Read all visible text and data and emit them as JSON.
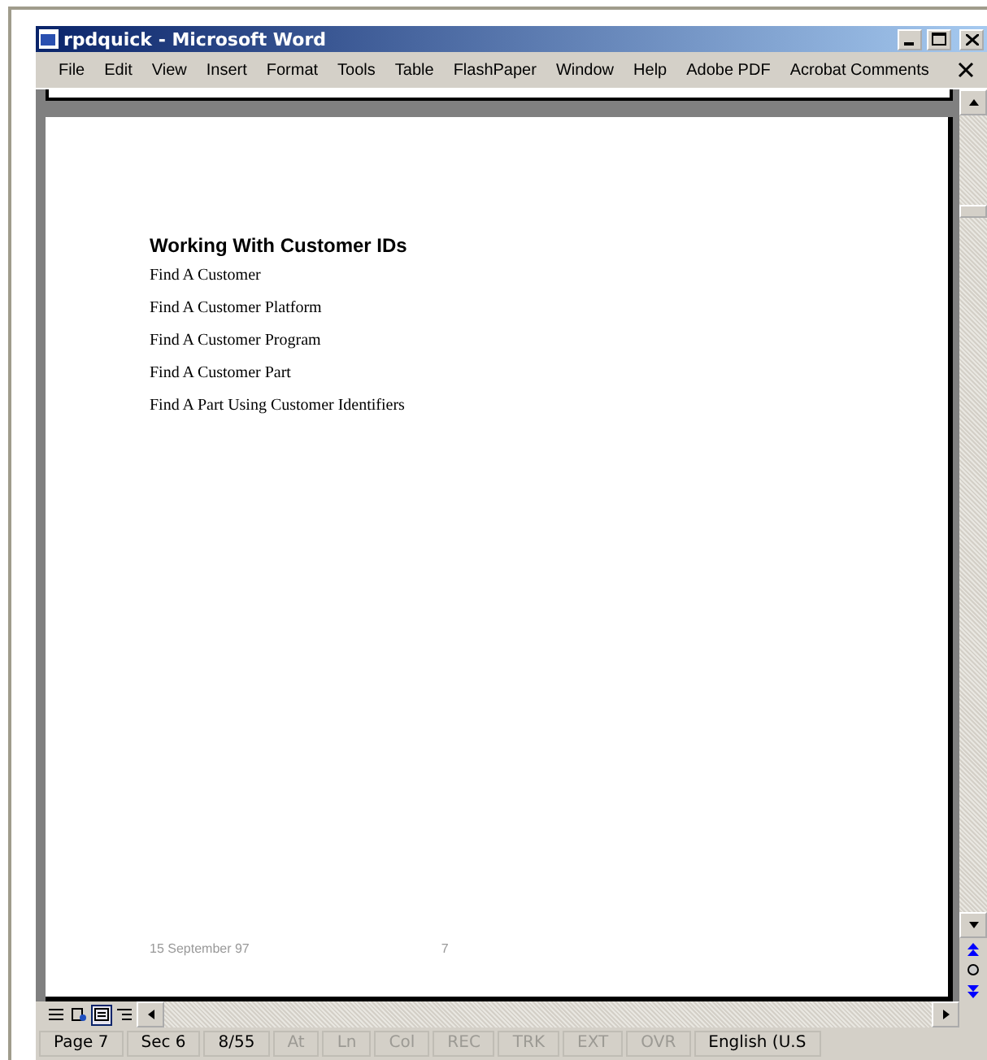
{
  "window": {
    "title": "rpdquick - Microsoft Word"
  },
  "menu": [
    "File",
    "Edit",
    "View",
    "Insert",
    "Format",
    "Tools",
    "Table",
    "FlashPaper",
    "Window",
    "Help",
    "Adobe PDF",
    "Acrobat Comments"
  ],
  "document": {
    "heading": "Working With Customer IDs",
    "links": [
      "Find A Customer",
      "Find A Customer Platform",
      "Find A Customer Program",
      "Find A Customer Part",
      "Find A Part Using Customer Identifiers"
    ],
    "footer_date": "15 September 97",
    "footer_page": "7"
  },
  "view_buttons": [
    {
      "kind": "normal",
      "selected": false
    },
    {
      "kind": "web",
      "selected": false
    },
    {
      "kind": "print",
      "selected": true
    },
    {
      "kind": "outline",
      "selected": false
    }
  ],
  "status_bar": [
    {
      "text": "Page 7",
      "disabled": false
    },
    {
      "text": "Sec 6",
      "disabled": false
    },
    {
      "text": "8/55",
      "disabled": false
    },
    {
      "text": "At",
      "disabled": true
    },
    {
      "text": "Ln",
      "disabled": true
    },
    {
      "text": "Col",
      "disabled": true
    },
    {
      "text": "REC",
      "disabled": true
    },
    {
      "text": "TRK",
      "disabled": true
    },
    {
      "text": "EXT",
      "disabled": true
    },
    {
      "text": "OVR",
      "disabled": true
    },
    {
      "text": "English (U.S",
      "disabled": false
    }
  ]
}
